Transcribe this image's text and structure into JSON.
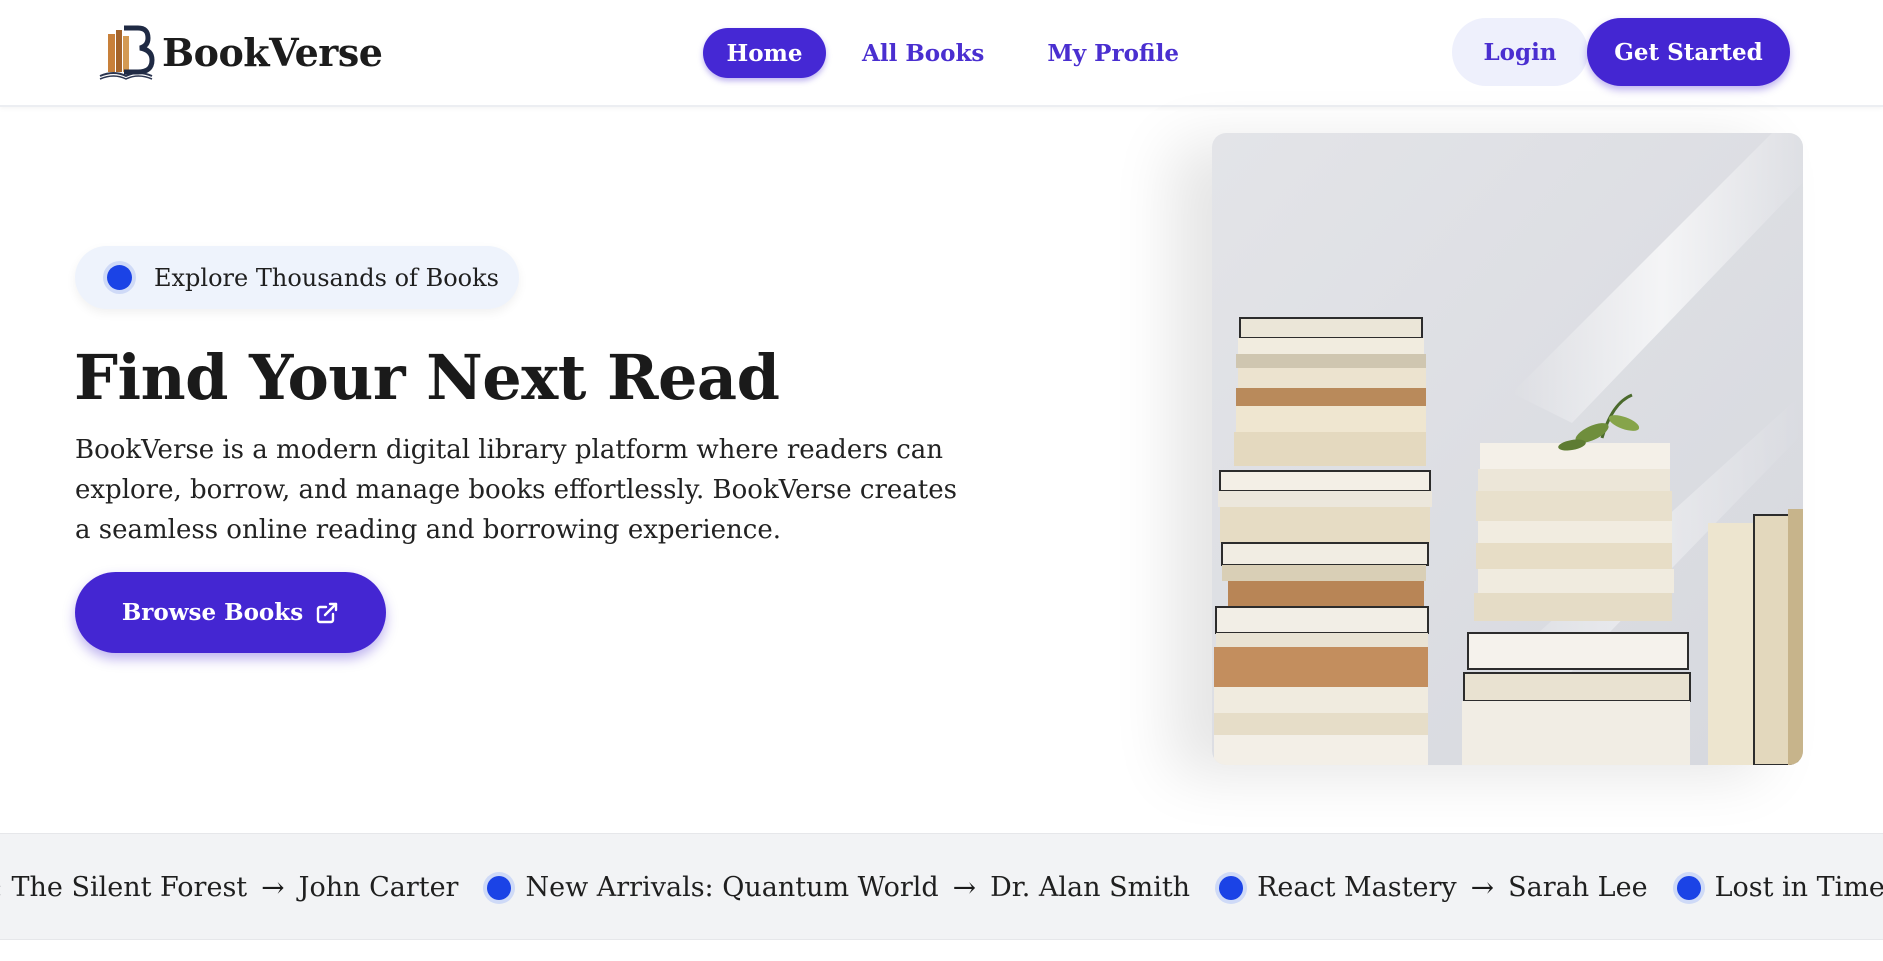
{
  "brand": {
    "name": "BookVerse",
    "logo_icon": "book-logo-icon"
  },
  "nav": {
    "items": [
      {
        "label": "Home",
        "active": true
      },
      {
        "label": "All Books",
        "active": false
      },
      {
        "label": "My Profile",
        "active": false
      }
    ]
  },
  "auth": {
    "login_label": "Login",
    "start_label": "Get Started"
  },
  "hero": {
    "badge": "Explore Thousands of Books",
    "title": "Find Your Next Read",
    "description": "BookVerse is a modern digital library platform where readers can explore, borrow, and manage books effortlessly. BookVerse creates a seamless online reading and borrowing experience.",
    "cta_label": "Browse Books",
    "cta_icon": "external-link-icon"
  },
  "ticker": {
    "items": [
      {
        "title": "vals: The Silent Forest",
        "author": "John Carter"
      },
      {
        "title": "New Arrivals: Quantum World",
        "author": "Dr. Alan Smith"
      },
      {
        "title": "React Mastery",
        "author": "Sarah Lee"
      },
      {
        "title": "Lost in Time",
        "author": ""
      }
    ]
  },
  "colors": {
    "primary": "#4426d2",
    "dot": "#1b43e6",
    "badge_bg": "#eef3fc",
    "ticker_bg": "#f2f3f5"
  }
}
